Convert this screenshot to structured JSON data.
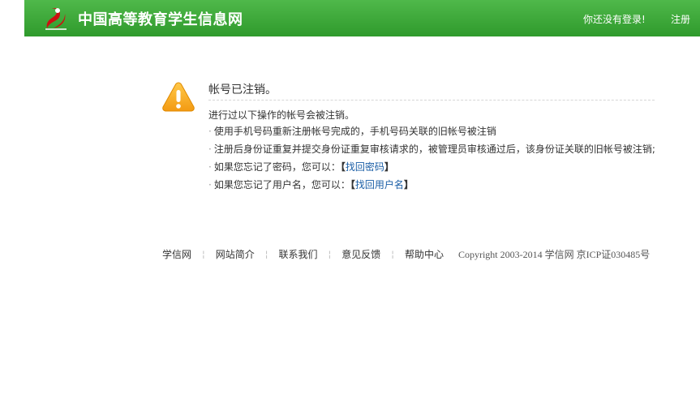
{
  "header": {
    "site_title": "中国高等教育学生信息网",
    "login_status": "你还没有登录!",
    "register_label": "注册",
    "logo_icon": "chsi-logo-icon",
    "background_color": "#3aa936"
  },
  "message": {
    "icon": "warning-icon",
    "title": "帐号已注销。",
    "intro": "进行过以下操作的帐号会被注销。",
    "bullets": [
      "使用手机号码重新注册帐号完成的，手机号码关联的旧帐号被注销",
      "注册后身份证重复并提交身份证重复审核请求的，被管理员审核通过后，该身份证关联的旧帐号被注销;"
    ],
    "recover_password": {
      "text": "如果您忘记了密码，您可以：",
      "link_label": "找回密码"
    },
    "recover_username": {
      "text": "如果您忘记了用户名，您可以：",
      "link_label": "找回用户名"
    },
    "warning_color": "#f5a623",
    "link_color": "#1a5ea6"
  },
  "footer": {
    "links": [
      "学信网",
      "网站简介",
      "联系我们",
      "意见反馈",
      "帮助中心"
    ],
    "copyright": "Copyright 2003-2014 学信网 京ICP证030485号"
  }
}
